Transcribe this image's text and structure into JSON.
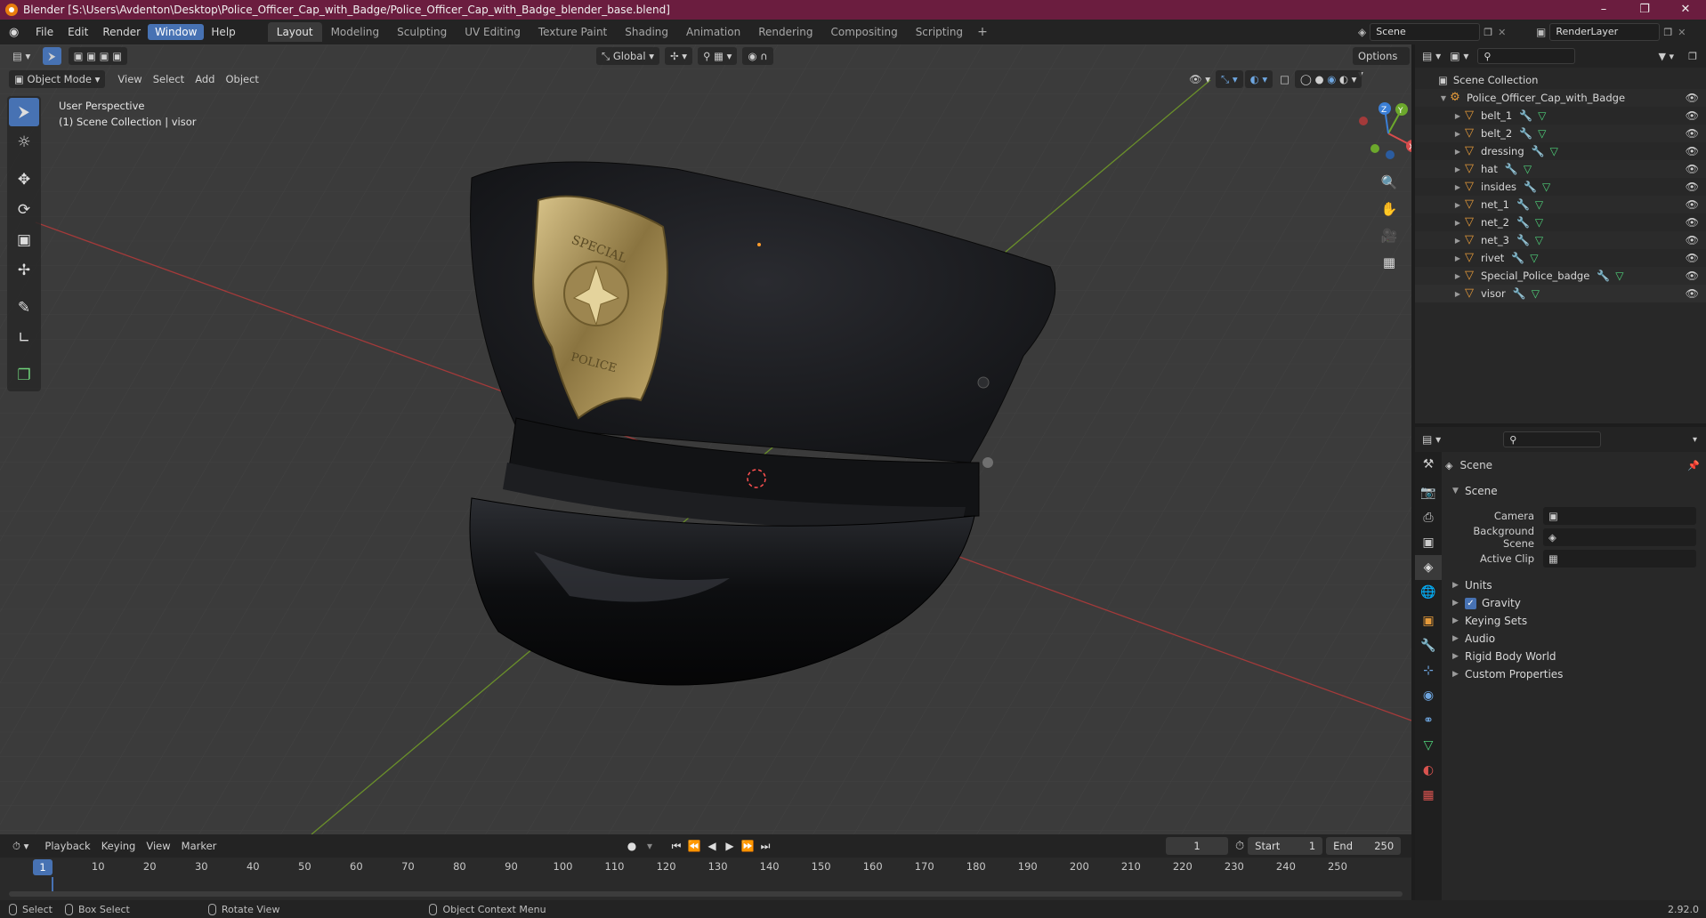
{
  "window": {
    "title": "Blender [S:\\Users\\Avdenton\\Desktop\\Police_Officer_Cap_with_Badge/Police_Officer_Cap_with_Badge_blender_base.blend]"
  },
  "menu": [
    "File",
    "Edit",
    "Render",
    "Window",
    "Help"
  ],
  "workspaces": [
    "Layout",
    "Modeling",
    "Sculpting",
    "UV Editing",
    "Texture Paint",
    "Shading",
    "Animation",
    "Rendering",
    "Compositing",
    "Scripting"
  ],
  "scene_selector": "Scene",
  "renderlayer_selector": "RenderLayer",
  "viewport": {
    "transform_orientation": "Global",
    "options_label": "Options",
    "mode": "Object Mode",
    "header_menus": [
      "View",
      "Select",
      "Add",
      "Object"
    ],
    "overlay_line1": "User Perspective",
    "overlay_line2": "(1) Scene Collection | visor",
    "badge_text_top": "SPECIAL",
    "badge_text_bottom": "POLICE",
    "gizmo_axes": {
      "x": "X",
      "y": "Y",
      "z": "Z"
    }
  },
  "outliner": {
    "root": "Scene Collection",
    "collection": "Police_Officer_Cap_with_Badge",
    "objects": [
      "belt_1",
      "belt_2",
      "dressing",
      "hat",
      "insides",
      "net_1",
      "net_2",
      "net_3",
      "rivet",
      "Special_Police_badge",
      "visor"
    ]
  },
  "properties": {
    "context_title": "Scene",
    "section_title": "Scene",
    "fields": [
      {
        "label": "Camera",
        "value": ""
      },
      {
        "label": "Background Scene",
        "value": ""
      },
      {
        "label": "Active Clip",
        "value": ""
      }
    ],
    "panels": [
      {
        "label": "Units",
        "checkbox": false
      },
      {
        "label": "Gravity",
        "checkbox": true
      },
      {
        "label": "Keying Sets",
        "checkbox": false
      },
      {
        "label": "Audio",
        "checkbox": false
      },
      {
        "label": "Rigid Body World",
        "checkbox": false
      },
      {
        "label": "Custom Properties",
        "checkbox": false
      }
    ]
  },
  "timeline": {
    "menus": [
      "Playback",
      "Keying",
      "View",
      "Marker"
    ],
    "current_frame": "1",
    "start_label": "Start",
    "start_value": "1",
    "end_label": "End",
    "end_value": "250",
    "ruler_current": "1",
    "ruler": [
      "10",
      "20",
      "30",
      "40",
      "50",
      "60",
      "70",
      "80",
      "90",
      "100",
      "110",
      "120",
      "130",
      "140",
      "150",
      "160",
      "170",
      "180",
      "190",
      "200",
      "210",
      "220",
      "230",
      "240",
      "250"
    ]
  },
  "statusbar": {
    "select": "Select",
    "box_select": "Box Select",
    "rotate_view": "Rotate View",
    "context_menu": "Object Context Menu",
    "version": "2.92.0"
  }
}
